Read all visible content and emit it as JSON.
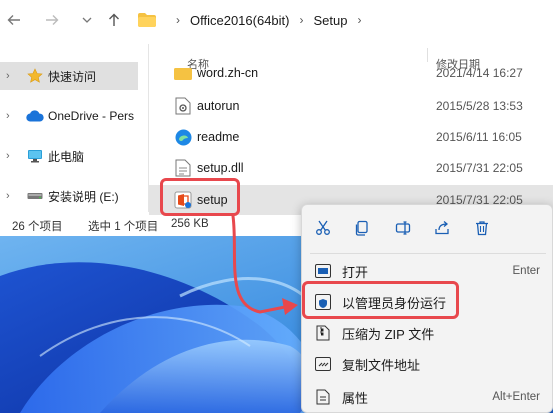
{
  "addressbar": {
    "breadcrumbs": [
      "Office2016(64bit)",
      "Setup"
    ]
  },
  "sidebar": {
    "items": [
      {
        "label": "快速访问",
        "icon": "star-icon"
      },
      {
        "label": "OneDrive - Pers",
        "icon": "cloud-icon"
      },
      {
        "label": "此电脑",
        "icon": "computer-icon"
      },
      {
        "label": "安装说明 (E:)",
        "icon": "drive-icon"
      }
    ]
  },
  "columns": {
    "name": "名称",
    "modified": "修改日期"
  },
  "files": [
    {
      "name": "word.zh-cn",
      "date": "2021/4/14 16:27",
      "icon": "folder-icon"
    },
    {
      "name": "autorun",
      "date": "2015/5/28 13:53",
      "icon": "config-file-icon"
    },
    {
      "name": "readme",
      "date": "2015/6/11 16:05",
      "icon": "edge-html-icon"
    },
    {
      "name": "setup.dll",
      "date": "2015/7/31 22:05",
      "icon": "dll-file-icon"
    },
    {
      "name": "setup",
      "date": "2015/7/31 22:05",
      "icon": "office-setup-icon"
    }
  ],
  "status": {
    "count": "26 个项目",
    "selected": "选中 1 个项目",
    "size": "256 KB"
  },
  "context_menu": {
    "quick_actions": [
      "cut-icon",
      "copy-icon",
      "rename-icon",
      "share-icon",
      "delete-icon"
    ],
    "items": [
      {
        "label": "打开",
        "shortcut": "Enter",
        "icon": "open-icon"
      },
      {
        "label": "以管理员身份运行",
        "shortcut": "",
        "icon": "shield-icon"
      },
      {
        "label": "压缩为 ZIP 文件",
        "shortcut": "",
        "icon": "zip-icon"
      },
      {
        "label": "复制文件地址",
        "shortcut": "",
        "icon": "copy-path-icon"
      },
      {
        "label": "属性",
        "shortcut": "Alt+Enter",
        "icon": "properties-icon"
      }
    ]
  },
  "colors": {
    "highlight": "#e8484d",
    "accent": "#0067c0",
    "selection": "#e4e4e4"
  }
}
